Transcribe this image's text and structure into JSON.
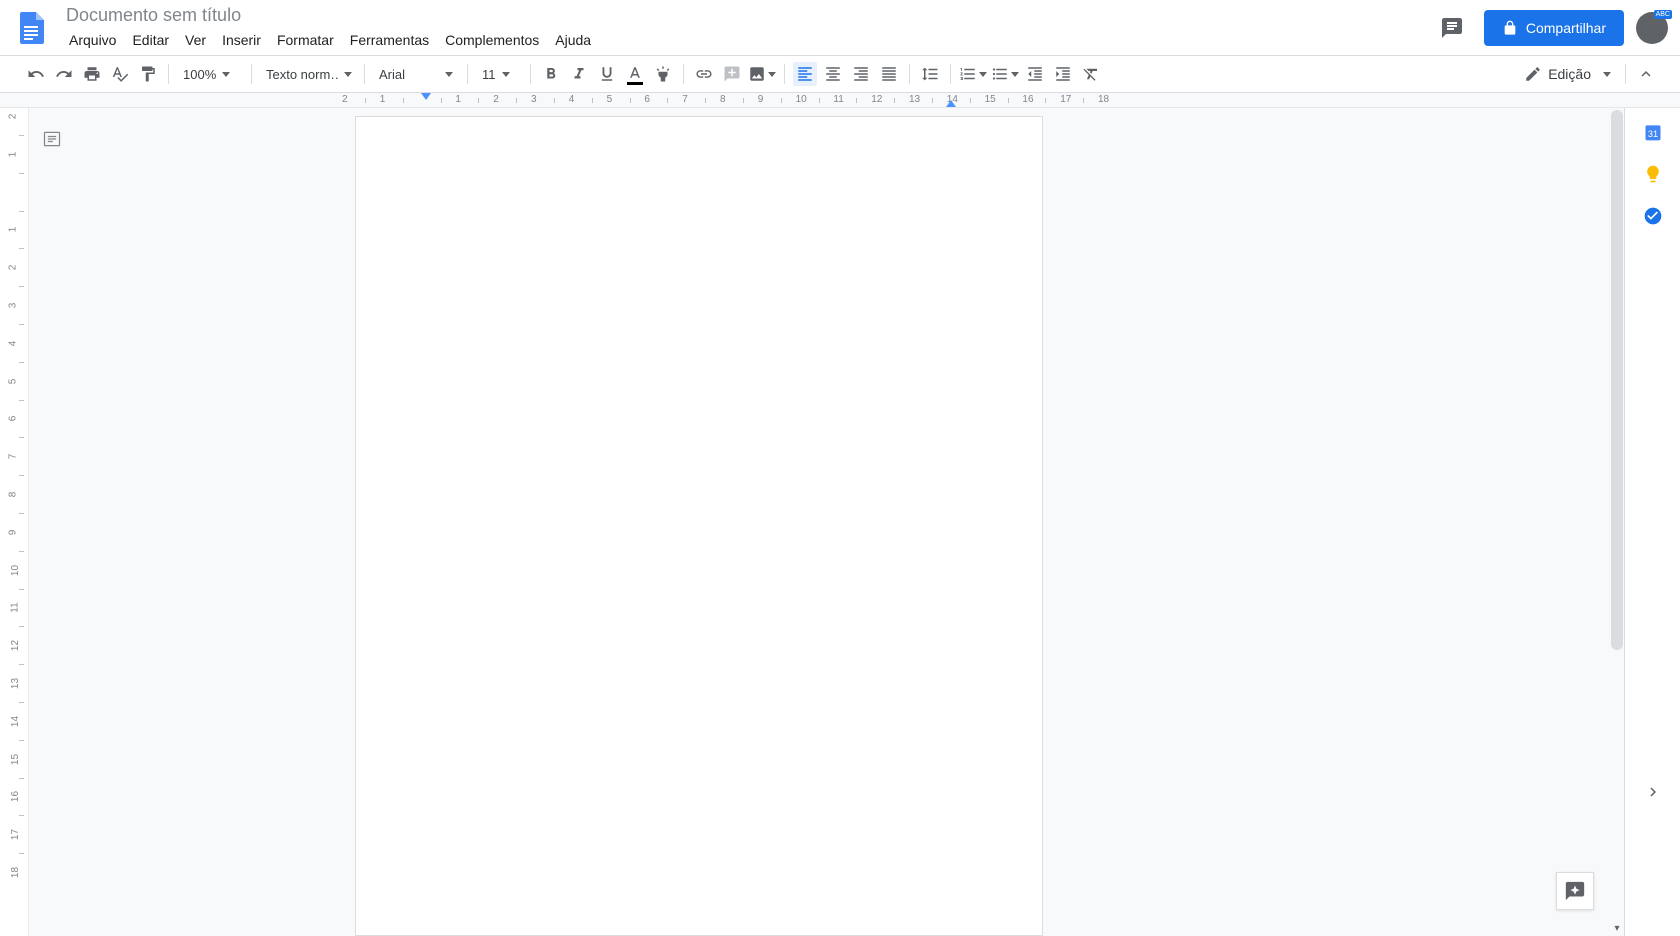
{
  "header": {
    "title": "Documento sem título",
    "share_label": "Compartilhar"
  },
  "menubar": {
    "items": [
      {
        "label": "Arquivo"
      },
      {
        "label": "Editar"
      },
      {
        "label": "Ver"
      },
      {
        "label": "Inserir"
      },
      {
        "label": "Formatar"
      },
      {
        "label": "Ferramentas"
      },
      {
        "label": "Complementos"
      },
      {
        "label": "Ajuda"
      }
    ]
  },
  "toolbar": {
    "zoom": "100%",
    "style": "Texto norm…",
    "font": "Arial",
    "font_size": "11",
    "mode": "Edição"
  },
  "ruler": {
    "h_start": -2,
    "h_end": 18,
    "v_start": -2,
    "v_end": 18
  }
}
